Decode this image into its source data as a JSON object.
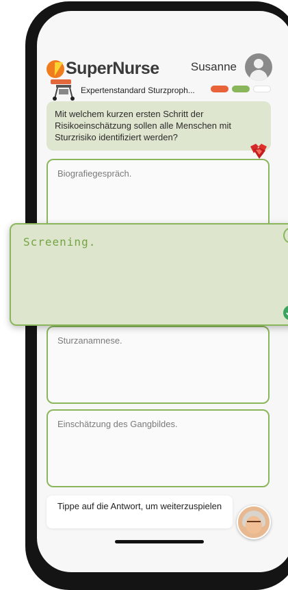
{
  "app": {
    "logo_text": "SuperNurse",
    "user_name": "Susanne"
  },
  "course": {
    "title": "Expertenstandard Sturzproph...",
    "progress_pills": [
      {
        "color": "#e8623a",
        "state": "wrong"
      },
      {
        "color": "#8ab65b",
        "state": "correct"
      },
      {
        "color": "#ffffff",
        "state": "pending"
      }
    ]
  },
  "question": {
    "text": "Mit welchem kurzen ersten Schritt der Risikoeinschätzung sollen alle Menschen mit Sturzrisiko identifiziert werden?"
  },
  "answers": [
    {
      "label": "Biografiegespräch."
    },
    {
      "label": "Screening."
    },
    {
      "label": "Sturzanamnese."
    },
    {
      "label": "Einschätzung des Gangbildes."
    }
  ],
  "selected_answer": {
    "label": "Screening."
  },
  "hint": {
    "text": "Tippe auf die Antwort, um weiterzuspielen"
  },
  "colors": {
    "accent_green": "#8ab65b",
    "answer_bg": "#fafafa",
    "question_bg": "#dfe6cf",
    "selected_bg": "#dde6cc",
    "logo_orange": "#f07c1e"
  }
}
